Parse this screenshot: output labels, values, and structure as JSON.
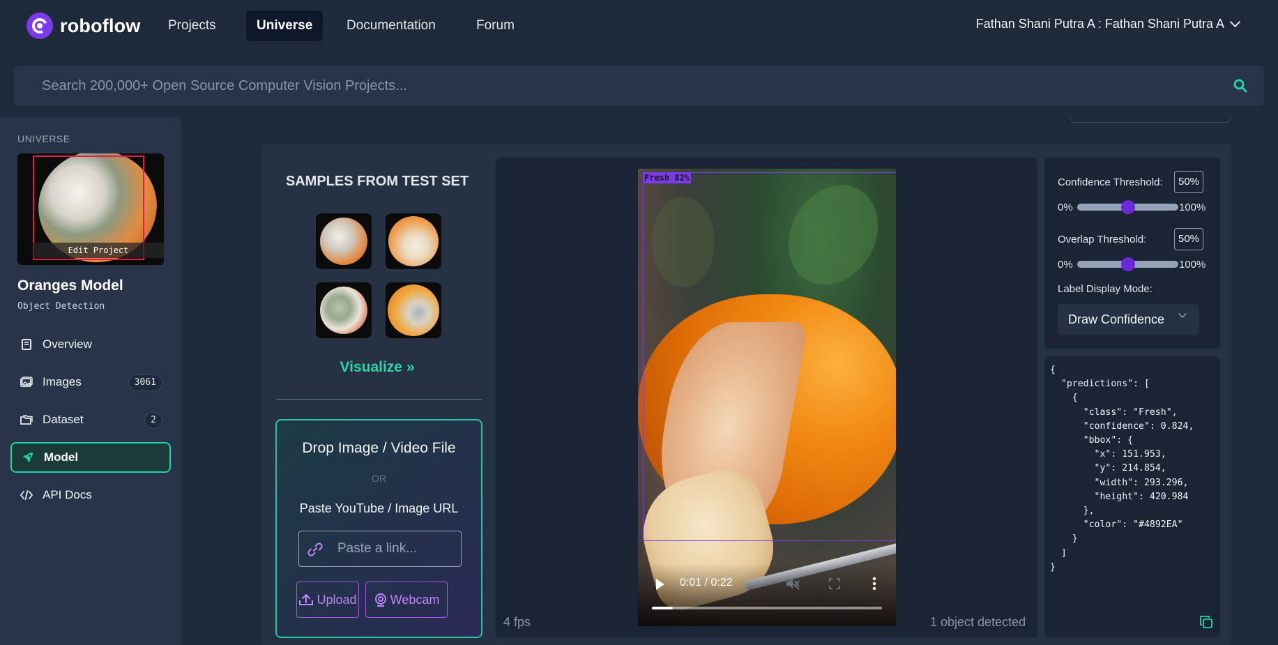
{
  "brand": {
    "name": "roboflow"
  },
  "nav": {
    "links": [
      "Projects",
      "Universe",
      "Documentation",
      "Forum"
    ],
    "active": "Universe",
    "user": "Fathan Shani Putra A : Fathan Shani Putra A"
  },
  "search": {
    "placeholder": "Search 200,000+ Open Source Computer Vision Projects..."
  },
  "sidebar": {
    "section": "UNIVERSE",
    "thumbnail_action": "Edit Project",
    "project_name": "Oranges Model",
    "project_type": "Object Detection",
    "items": [
      {
        "label": "Overview",
        "icon": "book-icon"
      },
      {
        "label": "Images",
        "icon": "images-icon",
        "count": "3061"
      },
      {
        "label": "Dataset",
        "icon": "folders-icon",
        "count": "2"
      },
      {
        "label": "Model",
        "icon": "rocket-icon",
        "active": true
      },
      {
        "label": "API Docs",
        "icon": "code-icon"
      }
    ]
  },
  "samples": {
    "title": "SAMPLES FROM TEST SET",
    "visualize_label": "Visualize »"
  },
  "upload": {
    "title": "Drop Image / Video File",
    "or": "OR",
    "url_label": "Paste YouTube / Image URL",
    "link_placeholder": "Paste a link...",
    "upload_label": "Upload",
    "webcam_label": "Webcam"
  },
  "video": {
    "detection_label": "Fresh 82%",
    "time": "0:01 / 0:22",
    "progress_fraction": 0.09,
    "fps": "4 fps",
    "detected": "1 object detected"
  },
  "settings": {
    "confidence_label": "Confidence Threshold:",
    "confidence_value": "50%",
    "confidence_fraction": 0.5,
    "overlap_label": "Overlap Threshold:",
    "overlap_value": "50%",
    "overlap_fraction": 0.5,
    "min": "0%",
    "max": "100%",
    "label_mode_label": "Label Display Mode:",
    "label_mode_value": "Draw Confidence"
  },
  "json_output": "{\n  \"predictions\": [\n    {\n      \"class\": \"Fresh\",\n      \"confidence\": 0.824,\n      \"bbox\": {\n        \"x\": 151.953,\n        \"y\": 214.854,\n        \"width\": 293.296,\n        \"height\": 420.984\n      },\n      \"color\": \"#4892EA\"\n    }\n  ]\n}",
  "colors": {
    "accent": "#22d3a8",
    "purple": "#7c3aed",
    "bbox": "#4892EA"
  }
}
